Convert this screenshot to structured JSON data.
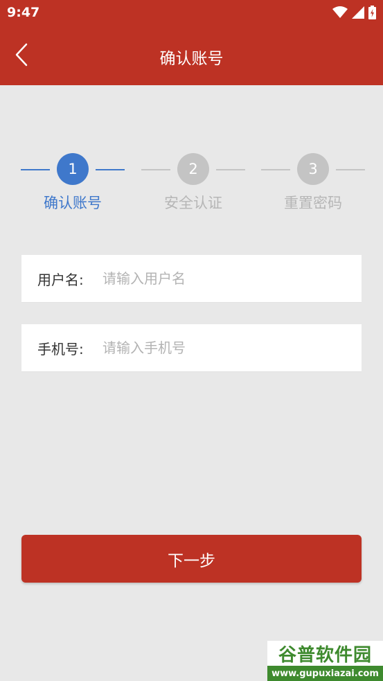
{
  "status_bar": {
    "time": "9:47",
    "icons": [
      "wifi-icon",
      "cell-signal-icon",
      "battery-charging-icon"
    ]
  },
  "app_bar": {
    "title": "确认账号",
    "back_icon": "chevron-left-icon"
  },
  "stepper": {
    "steps": [
      {
        "number": "1",
        "label": "确认账号",
        "active": true
      },
      {
        "number": "2",
        "label": "安全认证",
        "active": false
      },
      {
        "number": "3",
        "label": "重置密码",
        "active": false
      }
    ]
  },
  "form": {
    "username": {
      "label": "用户名:",
      "placeholder": "请输入用户名",
      "value": ""
    },
    "phone": {
      "label": "手机号:",
      "placeholder": "请输入手机号",
      "value": ""
    }
  },
  "next_button": {
    "label": "下一步"
  },
  "watermark": {
    "text": "谷普软件园",
    "url": "www.gupuxiazai.com"
  },
  "colors": {
    "primary_red": "#bd3224",
    "active_blue": "#3f78cb",
    "inactive_gray": "#c4c4c4",
    "background": "#e8e8e8"
  }
}
